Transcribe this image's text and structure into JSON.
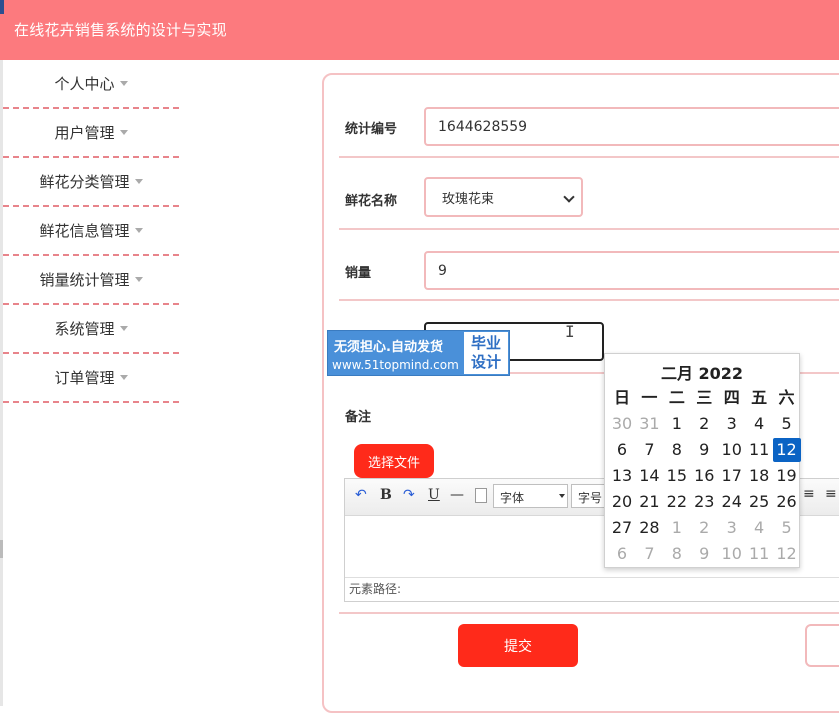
{
  "header": {
    "title": "在线花卉销售系统的设计与实现"
  },
  "sidebar": {
    "items": [
      {
        "label": "个人中心"
      },
      {
        "label": "用户管理"
      },
      {
        "label": "鲜花分类管理"
      },
      {
        "label": "鲜花信息管理"
      },
      {
        "label": "销量统计管理"
      },
      {
        "label": "系统管理"
      },
      {
        "label": "订单管理"
      }
    ]
  },
  "form": {
    "stat_no_label": "统计编号",
    "stat_no_value": "1644628559",
    "flower_name_label": "鲜花名称",
    "flower_name_value": "玫瑰花束",
    "sales_label": "销量",
    "sales_value": "9",
    "remark_label": "备注",
    "choose_file_label": "选择文件",
    "submit_label": "提交"
  },
  "watermark": {
    "line1": "无须担心.自动发货",
    "line2": "www.51topmind.com",
    "box_line1": "毕业",
    "box_line2": "设计"
  },
  "editor": {
    "toolbar": {
      "undo": "↶",
      "bold": "B",
      "redo": "↷",
      "underline": "U",
      "hr": "—",
      "font_family": "字体",
      "font_size": "字号"
    },
    "status_label": "元素路径:"
  },
  "calendar": {
    "month_label": "二月 2022",
    "weekdays": [
      "日",
      "一",
      "二",
      "三",
      "四",
      "五",
      "六"
    ],
    "weeks": [
      [
        "30",
        "31",
        "1",
        "2",
        "3",
        "4",
        "5"
      ],
      [
        "6",
        "7",
        "8",
        "9",
        "10",
        "11",
        "12"
      ],
      [
        "13",
        "14",
        "15",
        "16",
        "17",
        "18",
        "19"
      ],
      [
        "20",
        "21",
        "22",
        "23",
        "24",
        "25",
        "26"
      ],
      [
        "27",
        "28",
        "1",
        "2",
        "3",
        "4",
        "5"
      ],
      [
        "6",
        "7",
        "8",
        "9",
        "10",
        "11",
        "12"
      ]
    ],
    "selected": "12",
    "accent_color": "#0b63c4"
  },
  "colors": {
    "header_bg": "#fc7a7e",
    "button_red": "#ff2a1a",
    "border_pink": "#f2b9bb"
  }
}
